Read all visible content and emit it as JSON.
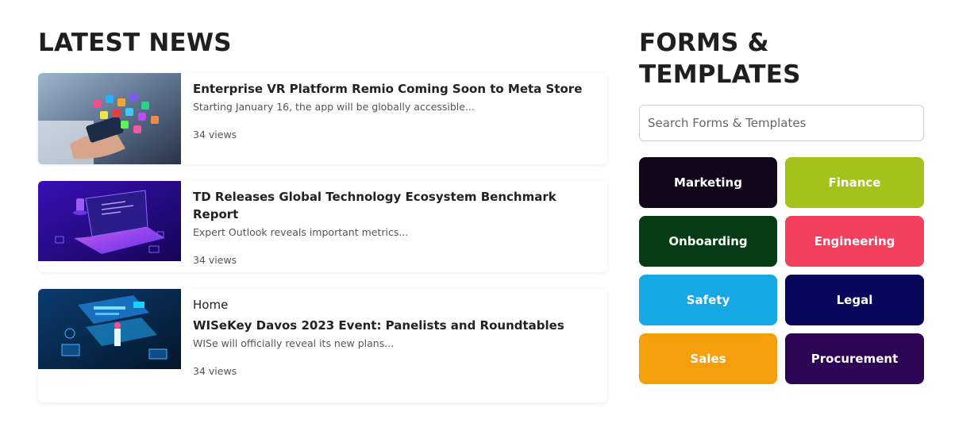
{
  "news": {
    "title": "LATEST NEWS",
    "items": [
      {
        "kicker": "",
        "title": "Enterprise VR Platform Remio Coming Soon to Meta Store",
        "excerpt": "Starting January 16, the app will be globally accessible...",
        "views": "34 views",
        "image": "hand-holding-app-icons-image"
      },
      {
        "kicker": "",
        "title": "TD Releases Global Technology Ecosystem Benchmark Report",
        "excerpt": "Expert Outlook reveals important metrics...",
        "views": "34 views",
        "image": "isometric-laptop-image"
      },
      {
        "kicker": "Home",
        "title": "WISeKey Davos 2023 Event: Panelists and Roundtables",
        "excerpt": "WISe will officially reveal its new plans...",
        "views": "34 views",
        "image": "isometric-data-center-image"
      }
    ]
  },
  "forms": {
    "title": "FORMS & TEMPLATES",
    "search_placeholder": "Search Forms & Templates",
    "categories": [
      {
        "label": "Marketing",
        "color": "#13051a"
      },
      {
        "label": "Finance",
        "color": "#a5c21c"
      },
      {
        "label": "Onboarding",
        "color": "#053c15"
      },
      {
        "label": "Engineering",
        "color": "#f4405f"
      },
      {
        "label": "Safety",
        "color": "#15a7e6"
      },
      {
        "label": "Legal",
        "color": "#08065a"
      },
      {
        "label": "Sales",
        "color": "#f59f0c"
      },
      {
        "label": "Procurement",
        "color": "#2c0654"
      }
    ]
  }
}
